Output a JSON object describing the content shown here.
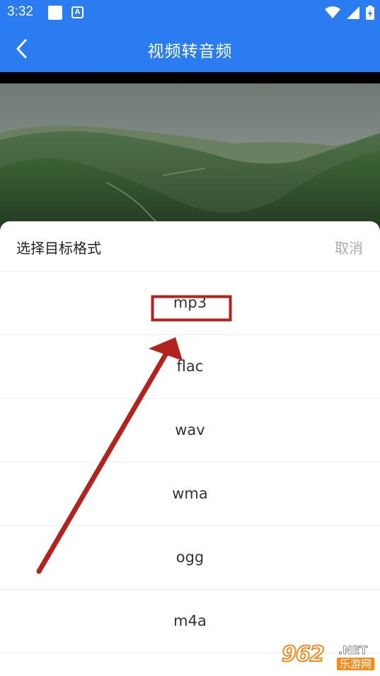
{
  "status_bar": {
    "time": "3:32",
    "notification_letter": "A"
  },
  "app_bar": {
    "title": "视频转音频"
  },
  "sheet": {
    "title": "选择目标格式",
    "cancel_label": "取消",
    "formats": [
      "mp3",
      "flac",
      "wav",
      "wma",
      "ogg",
      "m4a"
    ]
  },
  "watermark": {
    "number": "962",
    "suffix": ".NET",
    "subtitle": "乐游网"
  },
  "colors": {
    "accent": "#2a7cf0",
    "annotation": "#b3221c"
  }
}
